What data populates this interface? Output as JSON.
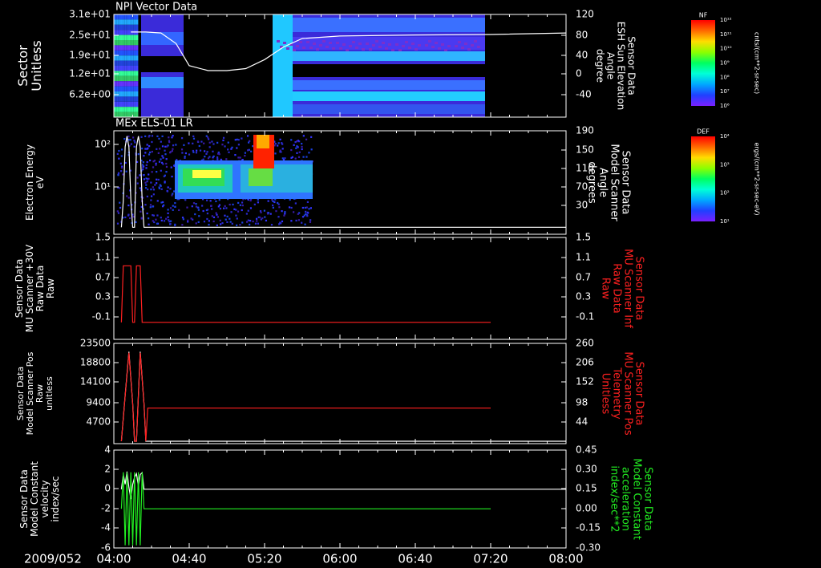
{
  "footer": {
    "date": "2009/052"
  },
  "time_axis": {
    "ticks": [
      "04:00",
      "04:40",
      "05:20",
      "06:00",
      "06:40",
      "07:20",
      "08:00"
    ]
  },
  "panels": {
    "p1": {
      "title": "NPI Vector Data",
      "ylabel": [
        "Sector",
        "Unitless"
      ],
      "yticks": [
        "3.1e+01",
        "2.5e+01",
        "1.9e+01",
        "1.2e+01",
        "6.2e+00"
      ],
      "y2label": [
        "Sensor Data",
        "ESH Sun Elevation",
        "Angle",
        "degree"
      ],
      "y2ticks": [
        "120",
        "80",
        "40",
        "0",
        "-40"
      ],
      "colorbar": {
        "label": "NF",
        "units": "cnts/(cm**2-sr-sec)",
        "ticks": [
          "10¹²",
          "10¹¹",
          "10¹⁰",
          "10⁹",
          "10⁸",
          "10⁷",
          "10⁶"
        ]
      }
    },
    "p2": {
      "title": "MEx ELS-01 LR",
      "ylabel": [
        "Electron Energy",
        "eV"
      ],
      "yticks": [
        "10²",
        "10¹"
      ],
      "y2label": [
        "Sensor Data",
        "Model Scanner",
        "Angle",
        "degrees"
      ],
      "y2ticks": [
        "190",
        "150",
        "110",
        "70",
        "30"
      ],
      "colorbar": {
        "label": "DEF",
        "units": "ergs/(cm**2-sr-sec-eV)",
        "ticks": [
          "10⁴",
          "10³",
          "10²",
          "10¹"
        ]
      }
    },
    "p3": {
      "ylabel": [
        "Sensor Data",
        "MU Scanner +30V",
        "Raw Data",
        "Raw"
      ],
      "yticks": [
        "1.5",
        "1.1",
        "0.7",
        "0.3",
        "-0.1"
      ],
      "y2label": [
        "Sensor Data",
        "MU Scanner Inf",
        "Raw Data",
        "Raw"
      ],
      "y2ticks": [
        "1.5",
        "1.1",
        "0.7",
        "0.3",
        "-0.1"
      ]
    },
    "p4": {
      "ylabel": [
        "Sensor Data",
        "Model Scanner Pos",
        "Raw",
        "unitless"
      ],
      "yticks": [
        "23500",
        "18800",
        "14100",
        "9400",
        "4700"
      ],
      "y2label": [
        "Sensor Data",
        "MU Scanner Pos",
        "Telemetry",
        "Unitless"
      ],
      "y2ticks": [
        "260",
        "206",
        "152",
        "98",
        "44"
      ]
    },
    "p5": {
      "ylabel": [
        "Sensor Data",
        "Model Constant",
        "velocity",
        "index/sec"
      ],
      "yticks": [
        "4",
        "2",
        "0",
        "-2",
        "-4",
        "-6"
      ],
      "y2label": [
        "Sensor Data",
        "Model Constant",
        "acceleration",
        "index/sec**2"
      ],
      "y2ticks": [
        "0.45",
        "0.30",
        "0.15",
        "0.00",
        "-0.15",
        "-0.30"
      ]
    }
  },
  "colors": {
    "red_trace": "#ff2020",
    "green_trace": "#22ee22",
    "white_trace": "#ffffff",
    "background": "#000000"
  },
  "chart_data": [
    {
      "type": "heatmap",
      "title": "NPI Vector Data",
      "ylabel": "Sector Unitless",
      "xlim": [
        "04:00",
        "08:00"
      ],
      "blocks": [
        {
          "t0": "04:00",
          "t1": "04:13",
          "level": "mixed"
        },
        {
          "t0": "04:13",
          "t1": "04:29",
          "level": "medium"
        },
        {
          "t0": "05:20",
          "t1": "07:20",
          "level": "low-medium"
        }
      ],
      "series": [
        {
          "name": "ESH Sun Elevation Angle",
          "x": [
            "04:09",
            "04:17",
            "04:25",
            "04:33",
            "04:40",
            "04:50",
            "05:00",
            "05:10",
            "05:20",
            "05:30",
            "05:40",
            "06:00",
            "06:40",
            "07:20",
            "08:00"
          ],
          "y": [
            85,
            85,
            83,
            62,
            18,
            8,
            8,
            12,
            30,
            55,
            72,
            77,
            79,
            80,
            83
          ]
        }
      ]
    },
    {
      "type": "heatmap",
      "title": "MEx ELS-01 LR",
      "ylabel": "Electron Energy eV",
      "y2label": "Model Scanner Angle degrees",
      "y2lim": [
        0,
        190
      ],
      "series": [
        {
          "name": "Model Scanner Angle",
          "x": [
            "04:04",
            "04:05",
            "04:06",
            "04:07",
            "04:08",
            "04:09",
            "04:10",
            "04:11",
            "04:12",
            "04:13",
            "04:14",
            "04:15",
            "04:16",
            "04:17",
            "04:18",
            "04:20",
            "08:00"
          ],
          "y": [
            10,
            60,
            160,
            180,
            160,
            60,
            10,
            10,
            160,
            180,
            160,
            60,
            10,
            10,
            10,
            10,
            10
          ]
        }
      ]
    },
    {
      "type": "line",
      "ylabel": "MU Scanner +30V Raw Data",
      "ylim": [
        -0.3,
        1.5
      ],
      "series": [
        {
          "name": "MU Scanner Inf Raw Data",
          "x": [
            "04:04",
            "04:05",
            "04:06",
            "04:09",
            "04:10",
            "04:11",
            "04:12",
            "04:14",
            "04:15",
            "04:16",
            "07:20"
          ],
          "y": [
            0,
            1,
            1,
            1,
            0,
            0,
            1,
            1,
            0,
            0,
            0
          ]
        }
      ]
    },
    {
      "type": "line",
      "ylabel": "Model Scanner Pos Raw unitless",
      "ylim": [
        0,
        23500
      ],
      "y2lim": [
        0,
        260
      ],
      "series": [
        {
          "name": "Model Scanner Pos",
          "x": [
            "04:04",
            "04:06",
            "04:08",
            "04:10",
            "04:11",
            "04:12",
            "04:14",
            "04:16",
            "04:17",
            "04:18",
            "08:00"
          ],
          "y": [
            0,
            11000,
            21500,
            9000,
            0,
            0,
            21500,
            9000,
            0,
            0,
            0
          ]
        },
        {
          "name": "MU Scanner Pos Telemetry",
          "x": [
            "04:04",
            "04:06",
            "04:08",
            "04:10",
            "04:11",
            "04:12",
            "04:14",
            "04:16",
            "04:17",
            "04:18",
            "07:20"
          ],
          "y": [
            0,
            120,
            235,
            100,
            0,
            0,
            235,
            100,
            0,
            88,
            88
          ]
        }
      ]
    },
    {
      "type": "line",
      "ylabel": "Model Constant velocity index/sec",
      "ylim": [
        -6,
        4
      ],
      "y2lim": [
        -0.3,
        0.45
      ],
      "series": [
        {
          "name": "Model Constant velocity",
          "x": [
            "04:04",
            "04:05",
            "04:06",
            "04:07",
            "04:08",
            "04:09",
            "04:10",
            "04:11",
            "04:12",
            "04:13",
            "04:14",
            "04:15",
            "04:16",
            "08:00"
          ],
          "y": [
            0,
            1.5,
            0.5,
            1.8,
            0.2,
            -1,
            0.5,
            1.2,
            1.6,
            0.3,
            1.5,
            1.7,
            0,
            0
          ]
        },
        {
          "name": "Model Constant acceleration",
          "x": [
            "04:04",
            "04:05",
            "04:06",
            "04:07",
            "04:08",
            "04:09",
            "04:10",
            "04:11",
            "04:12",
            "04:13",
            "04:14",
            "04:15",
            "04:16",
            "07:20"
          ],
          "y": [
            0.0,
            0.28,
            -0.28,
            0.28,
            -0.28,
            0.28,
            -0.28,
            0.28,
            -0.28,
            0.28,
            -0.28,
            0.28,
            0.0,
            0.0
          ]
        }
      ]
    }
  ]
}
